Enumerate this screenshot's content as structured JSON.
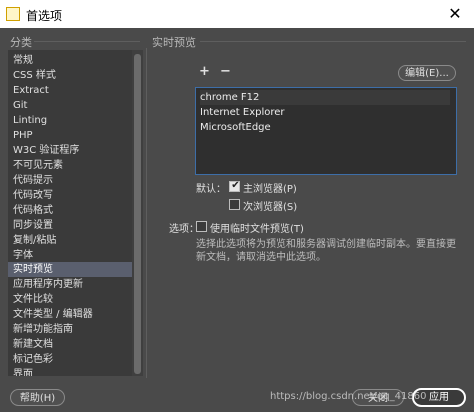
{
  "window": {
    "title": "首选项",
    "close_glyph": "✕"
  },
  "sidebar": {
    "header": "分类",
    "items": [
      {
        "label": "常规"
      },
      {
        "label": "CSS 样式"
      },
      {
        "label": "Extract"
      },
      {
        "label": "Git"
      },
      {
        "label": "Linting"
      },
      {
        "label": "PHP"
      },
      {
        "label": "W3C 验证程序"
      },
      {
        "label": "不可见元素"
      },
      {
        "label": "代码提示"
      },
      {
        "label": "代码改写"
      },
      {
        "label": "代码格式"
      },
      {
        "label": "同步设置"
      },
      {
        "label": "复制/粘贴"
      },
      {
        "label": "字体"
      },
      {
        "label": "实时预览",
        "selected": true
      },
      {
        "label": "应用程序内更新"
      },
      {
        "label": "文件比较"
      },
      {
        "label": "文件类型 / 编辑器"
      },
      {
        "label": "新增功能指南"
      },
      {
        "label": "新建文档"
      },
      {
        "label": "标记色彩"
      },
      {
        "label": "界面"
      }
    ]
  },
  "main": {
    "header": "实时预览",
    "add_label": "+",
    "remove_label": "−",
    "edit_label": "编辑(E)...",
    "browsers": [
      {
        "name": "chrome   F12"
      },
      {
        "name": "Internet Explorer"
      },
      {
        "name": "MicrosoftEdge"
      }
    ],
    "default_label": "默认：",
    "primary_browser": {
      "label": "主浏览器(P)",
      "checked": true
    },
    "secondary_browser": {
      "label": "次浏览器(S)",
      "checked": false
    },
    "options_label": "选项：",
    "temp_file": {
      "label": "使用临时文件预览(T)",
      "checked": false
    },
    "note": "选择此选项将为预览和服务器调试创建临时副本。要直接更新文档，请取消选中此选项。"
  },
  "footer": {
    "help_label": "帮助(H)",
    "close_label": "关闭",
    "apply_label": "应用",
    "watermark": "https://blog.csdn.net/qq_41860"
  },
  "colors": {
    "background": "#4a4a4a",
    "list_bg": "#3a3a3a",
    "selection": "#5a5f6e",
    "focus_border": "#3d6ea8"
  }
}
